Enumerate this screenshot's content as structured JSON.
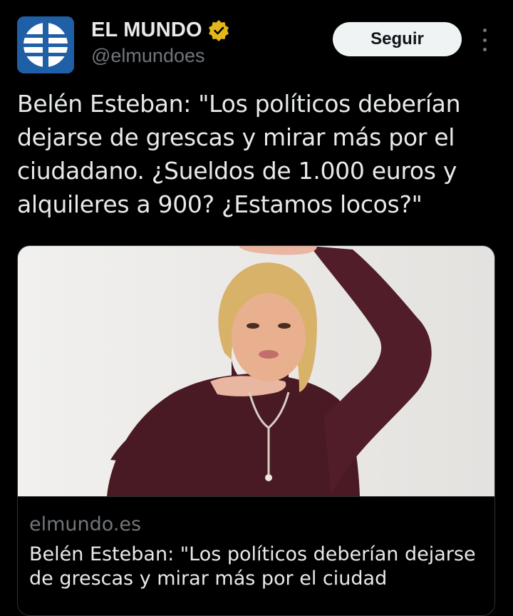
{
  "tweet": {
    "author_name": "EL MUNDO",
    "author_handle": "@elmundoes",
    "verified_icon": "verified-gold-badge-icon",
    "follow_label": "Seguir",
    "more_icon": "more-vertical-icon",
    "text": "Belén Esteban: \"Los políticos deberían dejarse de grescas y mirar más por el ciudadano. ¿Sueldos de 1.000 euros y alquileres a 900? ¿Estamos locos?\""
  },
  "card": {
    "image_subject": "photo-woman-burgundy-sweater",
    "domain": "elmundo.es",
    "title": "Belén Esteban: \"Los políticos deberían dejarse de grescas y mirar más por el ciudad"
  },
  "colors": {
    "background": "#000000",
    "text_primary": "#e7e9ea",
    "text_secondary": "#71767b",
    "brand_blue": "#1f5fa6",
    "verified_gold": "#e2b719",
    "follow_button_bg": "#eff3f4"
  }
}
